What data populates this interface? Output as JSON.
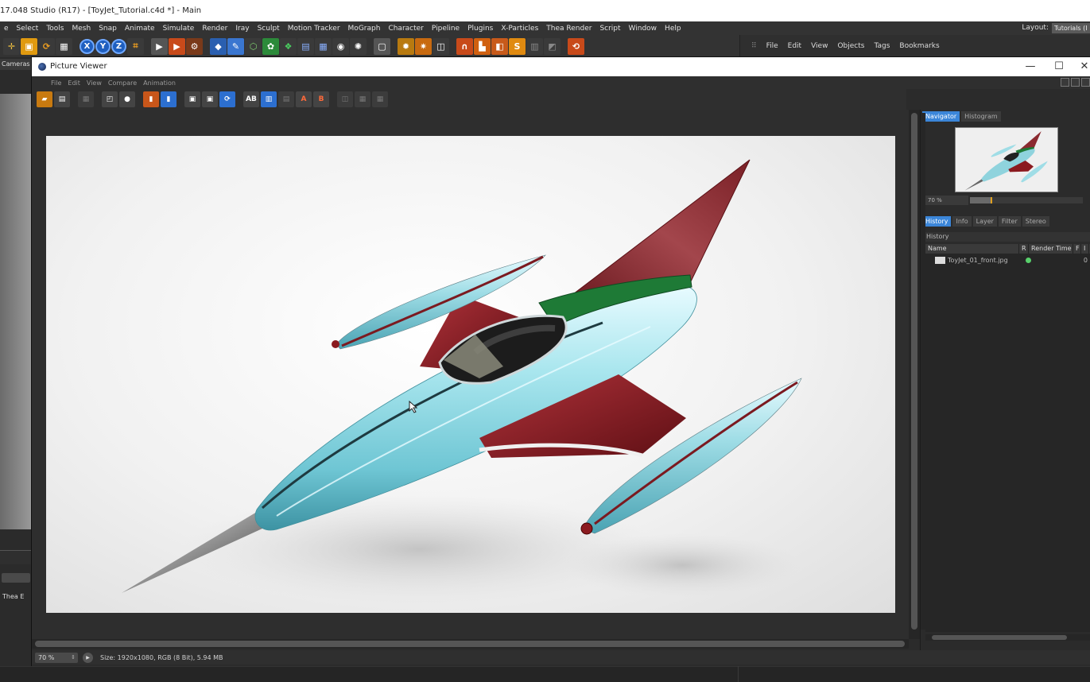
{
  "app": {
    "title": "17.048 Studio (R17) - [ToyJet_Tutorial.c4d *] - Main",
    "menu": [
      "e",
      "Select",
      "Tools",
      "Mesh",
      "Snap",
      "Animate",
      "Simulate",
      "Render",
      "Iray",
      "Sculpt",
      "Motion Tracker",
      "MoGraph",
      "Character",
      "Pipeline",
      "Plugins",
      "X-Particles",
      "Thea Render",
      "Script",
      "Window",
      "Help"
    ],
    "layout_label": "Layout:",
    "layout_value": "Tutorials (I",
    "axis_buttons": [
      "X",
      "Y",
      "Z"
    ]
  },
  "right_dock_menu": [
    "File",
    "Edit",
    "View",
    "Objects",
    "Tags",
    "Bookmarks"
  ],
  "left_panel": {
    "cameras_label": "Cameras",
    "thea_label": "Thea  E"
  },
  "picture_viewer": {
    "title": "Picture Viewer",
    "window_controls": {
      "minimize": "—",
      "maximize": "☐",
      "close": "✕"
    },
    "menu": [
      "File",
      "Edit",
      "View",
      "Compare",
      "Animation"
    ],
    "toolbar_glyphs": {
      "ab": "AB",
      "a": "A",
      "b": "B"
    },
    "status": {
      "zoom": "70 %",
      "text": "Size: 1920x1080, RGB (8 Bit), 5.94 MB"
    },
    "navigator": {
      "tabs": [
        "Navigator",
        "Histogram"
      ],
      "zoom": "70 %",
      "zoom_fraction": 0.2
    },
    "history": {
      "tabs": [
        "History",
        "Info",
        "Layer",
        "Filter",
        "Stereo"
      ],
      "header": "History",
      "columns": [
        "Name",
        "R",
        "Render Time",
        "F",
        "I"
      ],
      "rows": [
        {
          "name": "ToyJet_01_front.jpg",
          "status": "green-dot",
          "time": "0"
        }
      ]
    }
  },
  "colors": {
    "accent": "#3b86d9",
    "jet_body": "#9fdde6",
    "jet_wing": "#8b1a1f",
    "jet_canopy_band": "#1e7a36"
  }
}
